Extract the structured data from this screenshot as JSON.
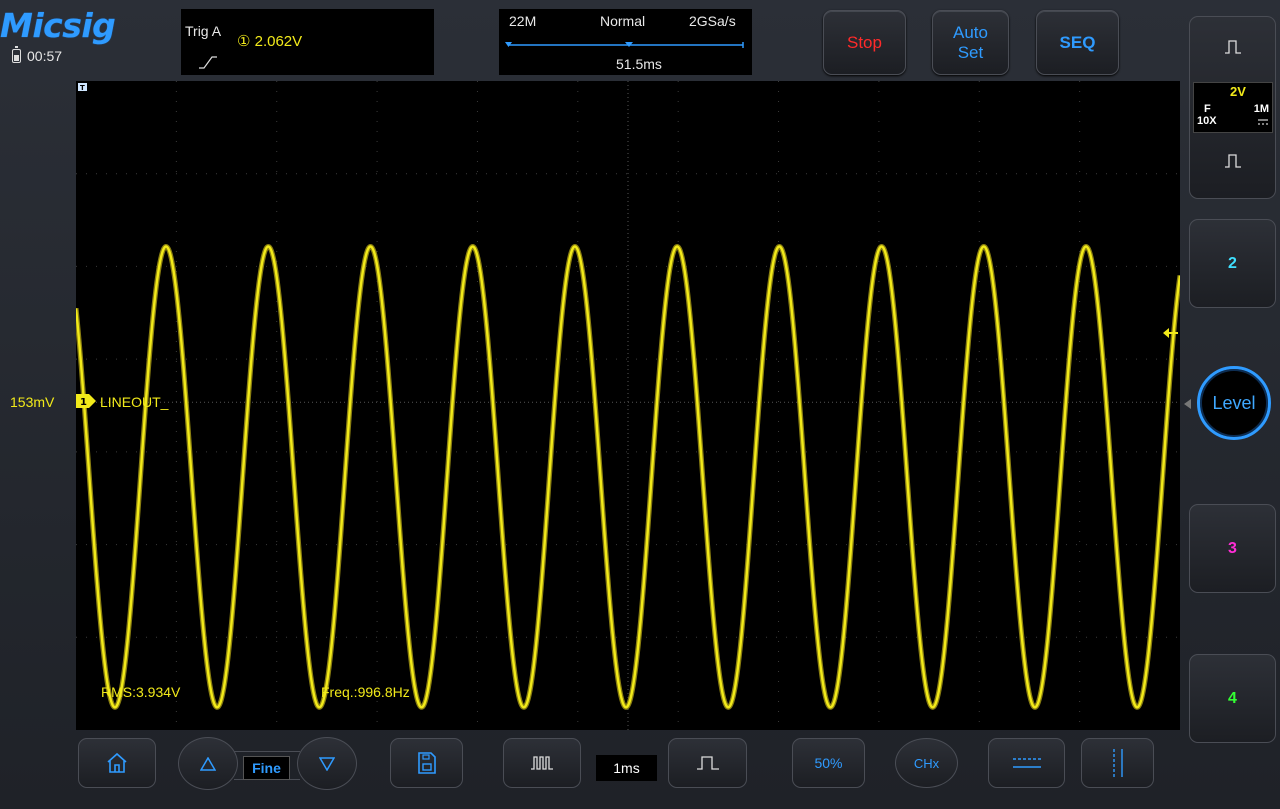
{
  "brand": {
    "logo": "Micsig"
  },
  "status": {
    "battery_icon": "battery-charging-icon",
    "clock": "00:57"
  },
  "trigger": {
    "label": "Trig  A",
    "level": "① 2.062V",
    "edge_icon": "rising-edge-icon"
  },
  "timebase": {
    "memory_depth": "22M",
    "acq_mode": "Normal",
    "sample_rate": "2GSa/s",
    "horizontal_position": "51.5ms"
  },
  "top_buttons": {
    "stop": "Stop",
    "auto_set_line1": "Auto",
    "auto_set_line2": "Set",
    "seq": "SEQ"
  },
  "channel1_panel": {
    "volts_per_div": "2V",
    "bandwidth": "F",
    "probe": "10X",
    "impedance": "1M",
    "coupling_icon": "dc-coupling-icon"
  },
  "side_buttons": {
    "ch2": "2",
    "level": "Level",
    "ch3": "3",
    "ch4": "4"
  },
  "waveform": {
    "channel_label": "LINEOUT_",
    "channel_marker": "1",
    "offset_label": "153mV",
    "measurements": {
      "rms": "RMS:3.934V",
      "freq": "Freq.:996.8Hz"
    },
    "trace_color": "#f2ea1a",
    "periods_on_screen": 10.8,
    "grid_divisions": {
      "horizontal": 11,
      "vertical": 7
    }
  },
  "bottom_bar": {
    "fine": "Fine",
    "timebase_value": "1ms",
    "fifty_percent": "50%",
    "chx": "CHx"
  },
  "colors": {
    "accent_blue": "#2f9bff",
    "ch1": "#f2ea1a",
    "ch2": "#3fe0ff",
    "ch3": "#ff2dd6",
    "ch4": "#33ff33",
    "stop": "#ff2a2a"
  }
}
